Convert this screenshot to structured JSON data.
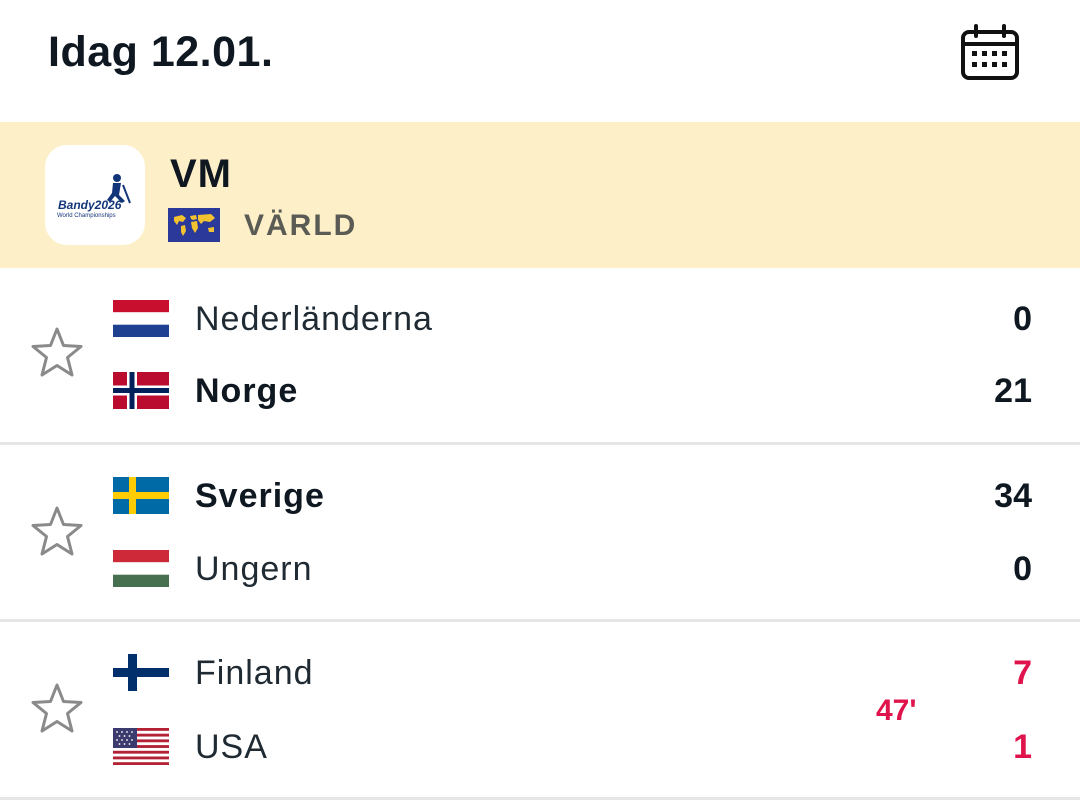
{
  "header": {
    "title": "Idag 12.01.",
    "calendar_icon": "calendar-icon"
  },
  "league": {
    "logo_text": "Bandy2026",
    "logo_subtext": "World Championships",
    "name": "VM",
    "region": "VÄRLD",
    "region_icon": "world-map-flag-icon"
  },
  "matches": [
    {
      "home": {
        "name": "Nederländerna",
        "score": "0",
        "bold": false,
        "flag": "netherlands-flag-icon"
      },
      "away": {
        "name": "Norge",
        "score": "21",
        "bold": true,
        "flag": "norway-flag-icon"
      },
      "minute": "",
      "live": false
    },
    {
      "home": {
        "name": "Sverige",
        "score": "34",
        "bold": true,
        "flag": "sweden-flag-icon"
      },
      "away": {
        "name": "Ungern",
        "score": "0",
        "bold": false,
        "flag": "hungary-flag-icon"
      },
      "minute": "",
      "live": false
    },
    {
      "home": {
        "name": "Finland",
        "score": "7",
        "bold": false,
        "flag": "finland-flag-icon"
      },
      "away": {
        "name": "USA",
        "score": "1",
        "bold": false,
        "flag": "usa-flag-icon"
      },
      "minute": "47'",
      "live": true
    }
  ],
  "colors": {
    "league_bg": "#fdefc7",
    "live": "#e0144c"
  }
}
